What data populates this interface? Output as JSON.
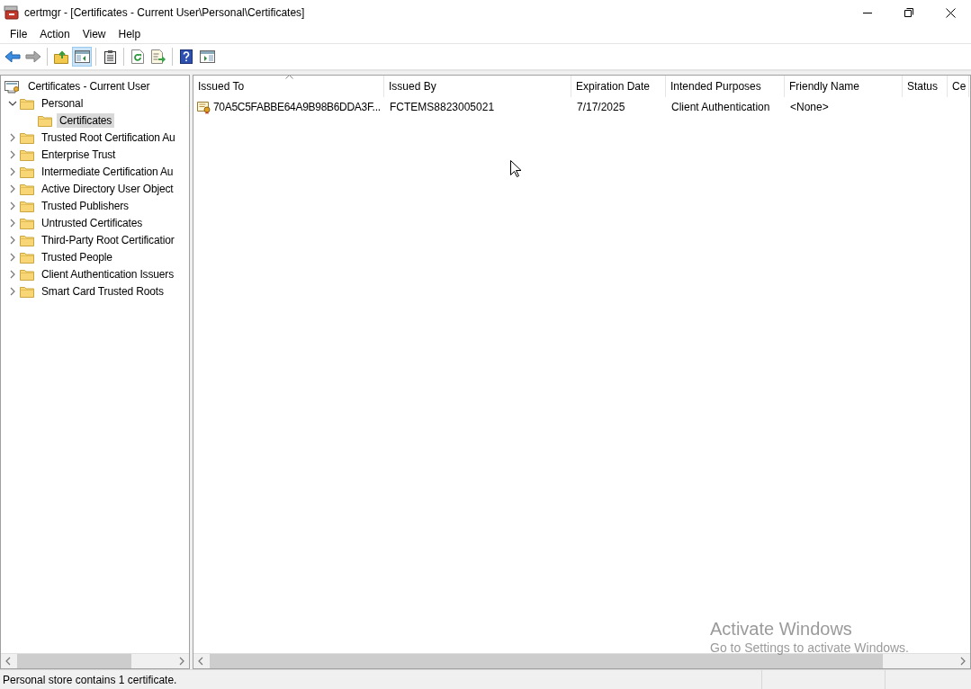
{
  "window": {
    "title": "certmgr - [Certificates - Current User\\Personal\\Certificates]"
  },
  "menu": [
    "File",
    "Action",
    "View",
    "Help"
  ],
  "toolbar": [
    {
      "kind": "back",
      "pressed": false,
      "disabled": false
    },
    {
      "kind": "forward",
      "pressed": false,
      "disabled": true
    },
    {
      "kind": "separator"
    },
    {
      "kind": "up",
      "pressed": false,
      "disabled": false
    },
    {
      "kind": "tree",
      "pressed": true,
      "disabled": false
    },
    {
      "kind": "separator"
    },
    {
      "kind": "properties",
      "pressed": false,
      "disabled": false
    },
    {
      "kind": "separator"
    },
    {
      "kind": "refresh",
      "pressed": false,
      "disabled": false
    },
    {
      "kind": "export",
      "pressed": false,
      "disabled": false
    },
    {
      "kind": "separator"
    },
    {
      "kind": "help",
      "pressed": false,
      "disabled": false
    },
    {
      "kind": "action_pane",
      "pressed": false,
      "disabled": false
    }
  ],
  "tree": {
    "label": "Certificates - Current User",
    "children": [
      {
        "label": "Personal",
        "expanded": true,
        "selected": false,
        "children": [
          {
            "label": "Certificates",
            "selected": true
          }
        ]
      },
      {
        "label": "Trusted Root Certification Au",
        "expanded": false,
        "selected": false
      },
      {
        "label": "Enterprise Trust",
        "expanded": false,
        "selected": false
      },
      {
        "label": "Intermediate Certification Au",
        "expanded": false,
        "selected": false
      },
      {
        "label": "Active Directory User Object",
        "expanded": false,
        "selected": false
      },
      {
        "label": "Trusted Publishers",
        "expanded": false,
        "selected": false
      },
      {
        "label": "Untrusted Certificates",
        "expanded": false,
        "selected": false
      },
      {
        "label": "Third-Party Root Certificatior",
        "expanded": false,
        "selected": false
      },
      {
        "label": "Trusted People",
        "expanded": false,
        "selected": false
      },
      {
        "label": "Client Authentication Issuers",
        "expanded": false,
        "selected": false
      },
      {
        "label": "Smart Card Trusted Roots",
        "expanded": false,
        "selected": false
      }
    ]
  },
  "table": {
    "columns": [
      {
        "label": "Issued To",
        "sorted": true
      },
      {
        "label": "Issued By",
        "sorted": false
      },
      {
        "label": "Expiration Date",
        "sorted": false
      },
      {
        "label": "Intended Purposes",
        "sorted": false
      },
      {
        "label": "Friendly Name",
        "sorted": false
      },
      {
        "label": "Status",
        "sorted": false
      },
      {
        "label": "Ce",
        "sorted": false
      }
    ],
    "rows": [
      {
        "cells": [
          "70A5C5FABBE64A9B98B6DDA3F...",
          "FCTEMS8823005021",
          "7/17/2025",
          "Client Authentication",
          "<None>"
        ]
      }
    ]
  },
  "status_bar": {
    "text": "Personal store contains 1 certificate."
  },
  "activation_notice": {
    "title": "Activate Windows",
    "subtitle": "Go to Settings to activate Windows."
  }
}
